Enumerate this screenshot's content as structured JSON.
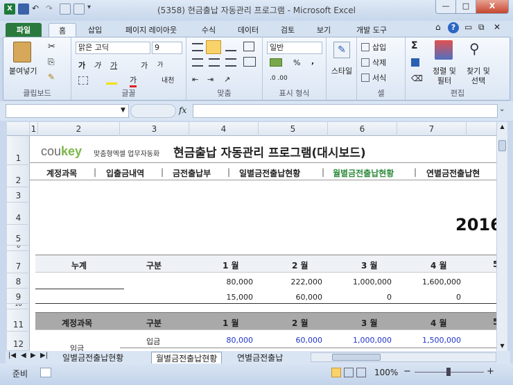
{
  "window": {
    "title": "(5358) 현금출납 자동관리 프로그램 - Microsoft Excel",
    "min_label": "—",
    "max_label": "□",
    "close_label": "X"
  },
  "tabs": [
    "파일",
    "홈",
    "삽입",
    "페이지 레이아웃",
    "수식",
    "데이터",
    "검토",
    "보기",
    "개발 도구"
  ],
  "ribbon": {
    "clipboard": {
      "paste": "붙여넣기",
      "label": "클립보드"
    },
    "font": {
      "name": "맑은 고딕",
      "size": "9",
      "bold": "가",
      "italic": "가",
      "underline": "가",
      "grow": "가",
      "shrink": "가",
      "phonetic": "내천",
      "color": "가",
      "label": "글꼴"
    },
    "alignment": {
      "label": "맞춤"
    },
    "number": {
      "format": "일반",
      "percent": "%",
      "comma": ",",
      "label": "표시 형식"
    },
    "styles": {
      "style": "스타일",
      "label": ""
    },
    "cells": {
      "insert": "삽입",
      "delete": "삭제",
      "format": "서식",
      "label": "셀"
    },
    "editing": {
      "sum": "Σ",
      "sort_filter": "정렬 및 필터",
      "find_select": "찾기 및 선택",
      "label": "편집"
    }
  },
  "formula_bar": {
    "fx": "fx",
    "value": ""
  },
  "columns": [
    "1",
    "2",
    "3",
    "4",
    "5",
    "6",
    "7"
  ],
  "rows": [
    "1",
    "2",
    "3",
    "4",
    "5",
    "6",
    "7",
    "8",
    "9",
    "10",
    "11",
    "12"
  ],
  "sheet": {
    "logo": {
      "co": "cou",
      "key": "key",
      "tag": "맞춤형엑셀 업무자동화"
    },
    "title": "현금출납 자동관리 프로그램(대시보드)",
    "menu": [
      "계정과목",
      "입출금내역",
      "금전출납부",
      "일별금전출납현황",
      "월별금전출납현황",
      "연별금전출납현"
    ],
    "menu_active_color": "#2e8b3a",
    "year": "2016",
    "summary": {
      "headers": [
        "누계",
        "구분",
        "1 월",
        "2 월",
        "3 월",
        "4 월",
        "5"
      ],
      "rows": [
        [
          "",
          "",
          "80,000",
          "222,000",
          "1,000,000",
          "1,600,000"
        ],
        [
          "",
          "",
          "15,000",
          "60,000",
          "0",
          "0"
        ]
      ]
    },
    "accounts": {
      "headers": [
        "계정과목",
        "구분",
        "1 월",
        "2 월",
        "3 월",
        "4 월",
        "5"
      ],
      "row": {
        "account": "임금",
        "kind": "입금",
        "values": [
          "80,000",
          "60,000",
          "1,000,000",
          "1,500,000"
        ]
      }
    }
  },
  "sheet_tabs": [
    "일별금전출납현황",
    "월별금전출납현황",
    "연별금전출납"
  ],
  "status": {
    "ready": "준비",
    "zoom": "100%",
    "minus": "−",
    "plus": "+"
  }
}
